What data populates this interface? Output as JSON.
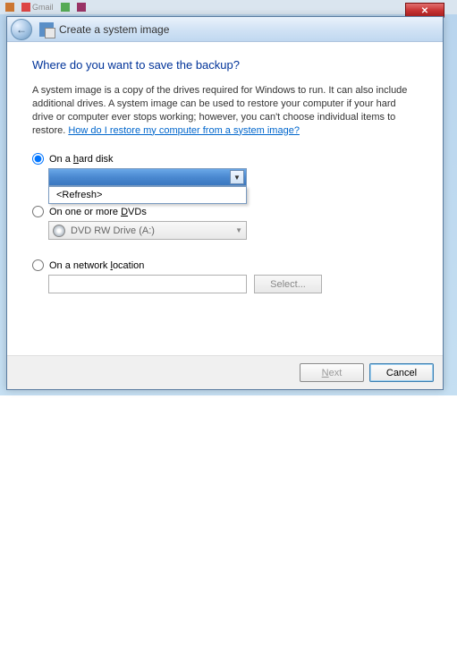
{
  "taskbar": {
    "tabs": [
      "",
      "Gmail",
      "",
      ""
    ]
  },
  "window": {
    "title": "Create a system image",
    "close_symbol": "✕"
  },
  "page": {
    "heading": "Where do you want to save the backup?",
    "description": "A system image is a copy of the drives required for Windows to run. It can also include additional drives. A system image can be used to restore your computer if your hard drive or computer ever stops working; however, you can't choose individual items to restore. ",
    "help_link": "How do I restore my computer from a system image?"
  },
  "options": {
    "hard_disk": {
      "label_pre": "On a ",
      "label_u": "h",
      "label_post": "ard disk",
      "selected": true,
      "dropdown_item": "<Refresh>"
    },
    "dvd": {
      "label_pre": "On one or more ",
      "label_u": "D",
      "label_post": "VDs",
      "selected": false,
      "drive_label": "DVD RW Drive (A:)"
    },
    "network": {
      "label_pre": "On a network ",
      "label_u": "l",
      "label_post": "ocation",
      "selected": false,
      "value": "",
      "select_button": "Select..."
    }
  },
  "footer": {
    "next_u": "N",
    "next_post": "ext",
    "cancel": "Cancel"
  }
}
